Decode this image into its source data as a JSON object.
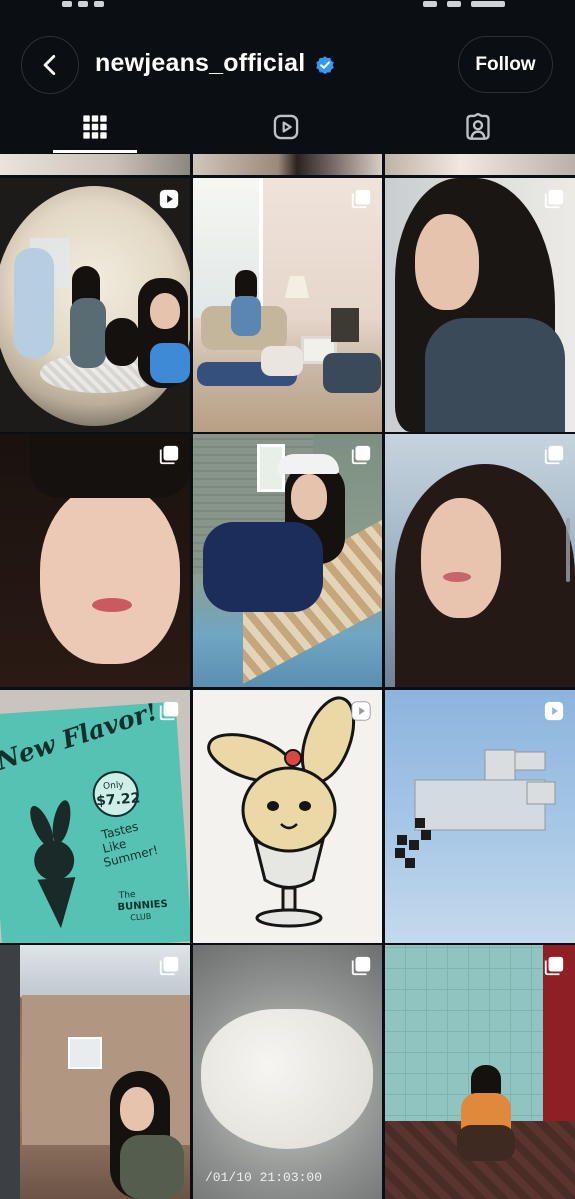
{
  "header": {
    "username": "newjeans_official",
    "follow_label": "Follow",
    "verified": true
  },
  "tabs": [
    {
      "name": "posts-grid",
      "icon": "grid-icon",
      "selected": true
    },
    {
      "name": "reels",
      "icon": "reels-icon",
      "selected": false
    },
    {
      "name": "tagged",
      "icon": "tagged-person-icon",
      "selected": false
    }
  ],
  "posts": [
    {
      "type": "reel",
      "badge_icon": "reel-icon"
    },
    {
      "type": "carousel",
      "badge_icon": "carousel-icon"
    },
    {
      "type": "carousel",
      "badge_icon": "carousel-icon"
    },
    {
      "type": "carousel",
      "badge_icon": "carousel-icon"
    },
    {
      "type": "carousel",
      "badge_icon": "carousel-icon"
    },
    {
      "type": "carousel",
      "badge_icon": "carousel-icon"
    },
    {
      "type": "carousel",
      "badge_icon": "carousel-icon",
      "flyer_text": [
        "New Flavor!",
        "Only",
        "$7.22",
        "Tastes",
        "Like",
        "Summer!",
        "The",
        "BUNNIES",
        "CLUB"
      ]
    },
    {
      "type": "reel",
      "badge_icon": "reel-icon"
    },
    {
      "type": "reel",
      "badge_icon": "reel-icon"
    },
    {
      "type": "carousel",
      "badge_icon": "carousel-icon"
    },
    {
      "type": "carousel",
      "badge_icon": "carousel-icon",
      "timestamp": "/01/10 21:03:00"
    },
    {
      "type": "carousel",
      "badge_icon": "carousel-icon"
    }
  ],
  "colors": {
    "background": "#0b0f14",
    "verified_blue": "#3897f0",
    "text": "#ffffff"
  }
}
